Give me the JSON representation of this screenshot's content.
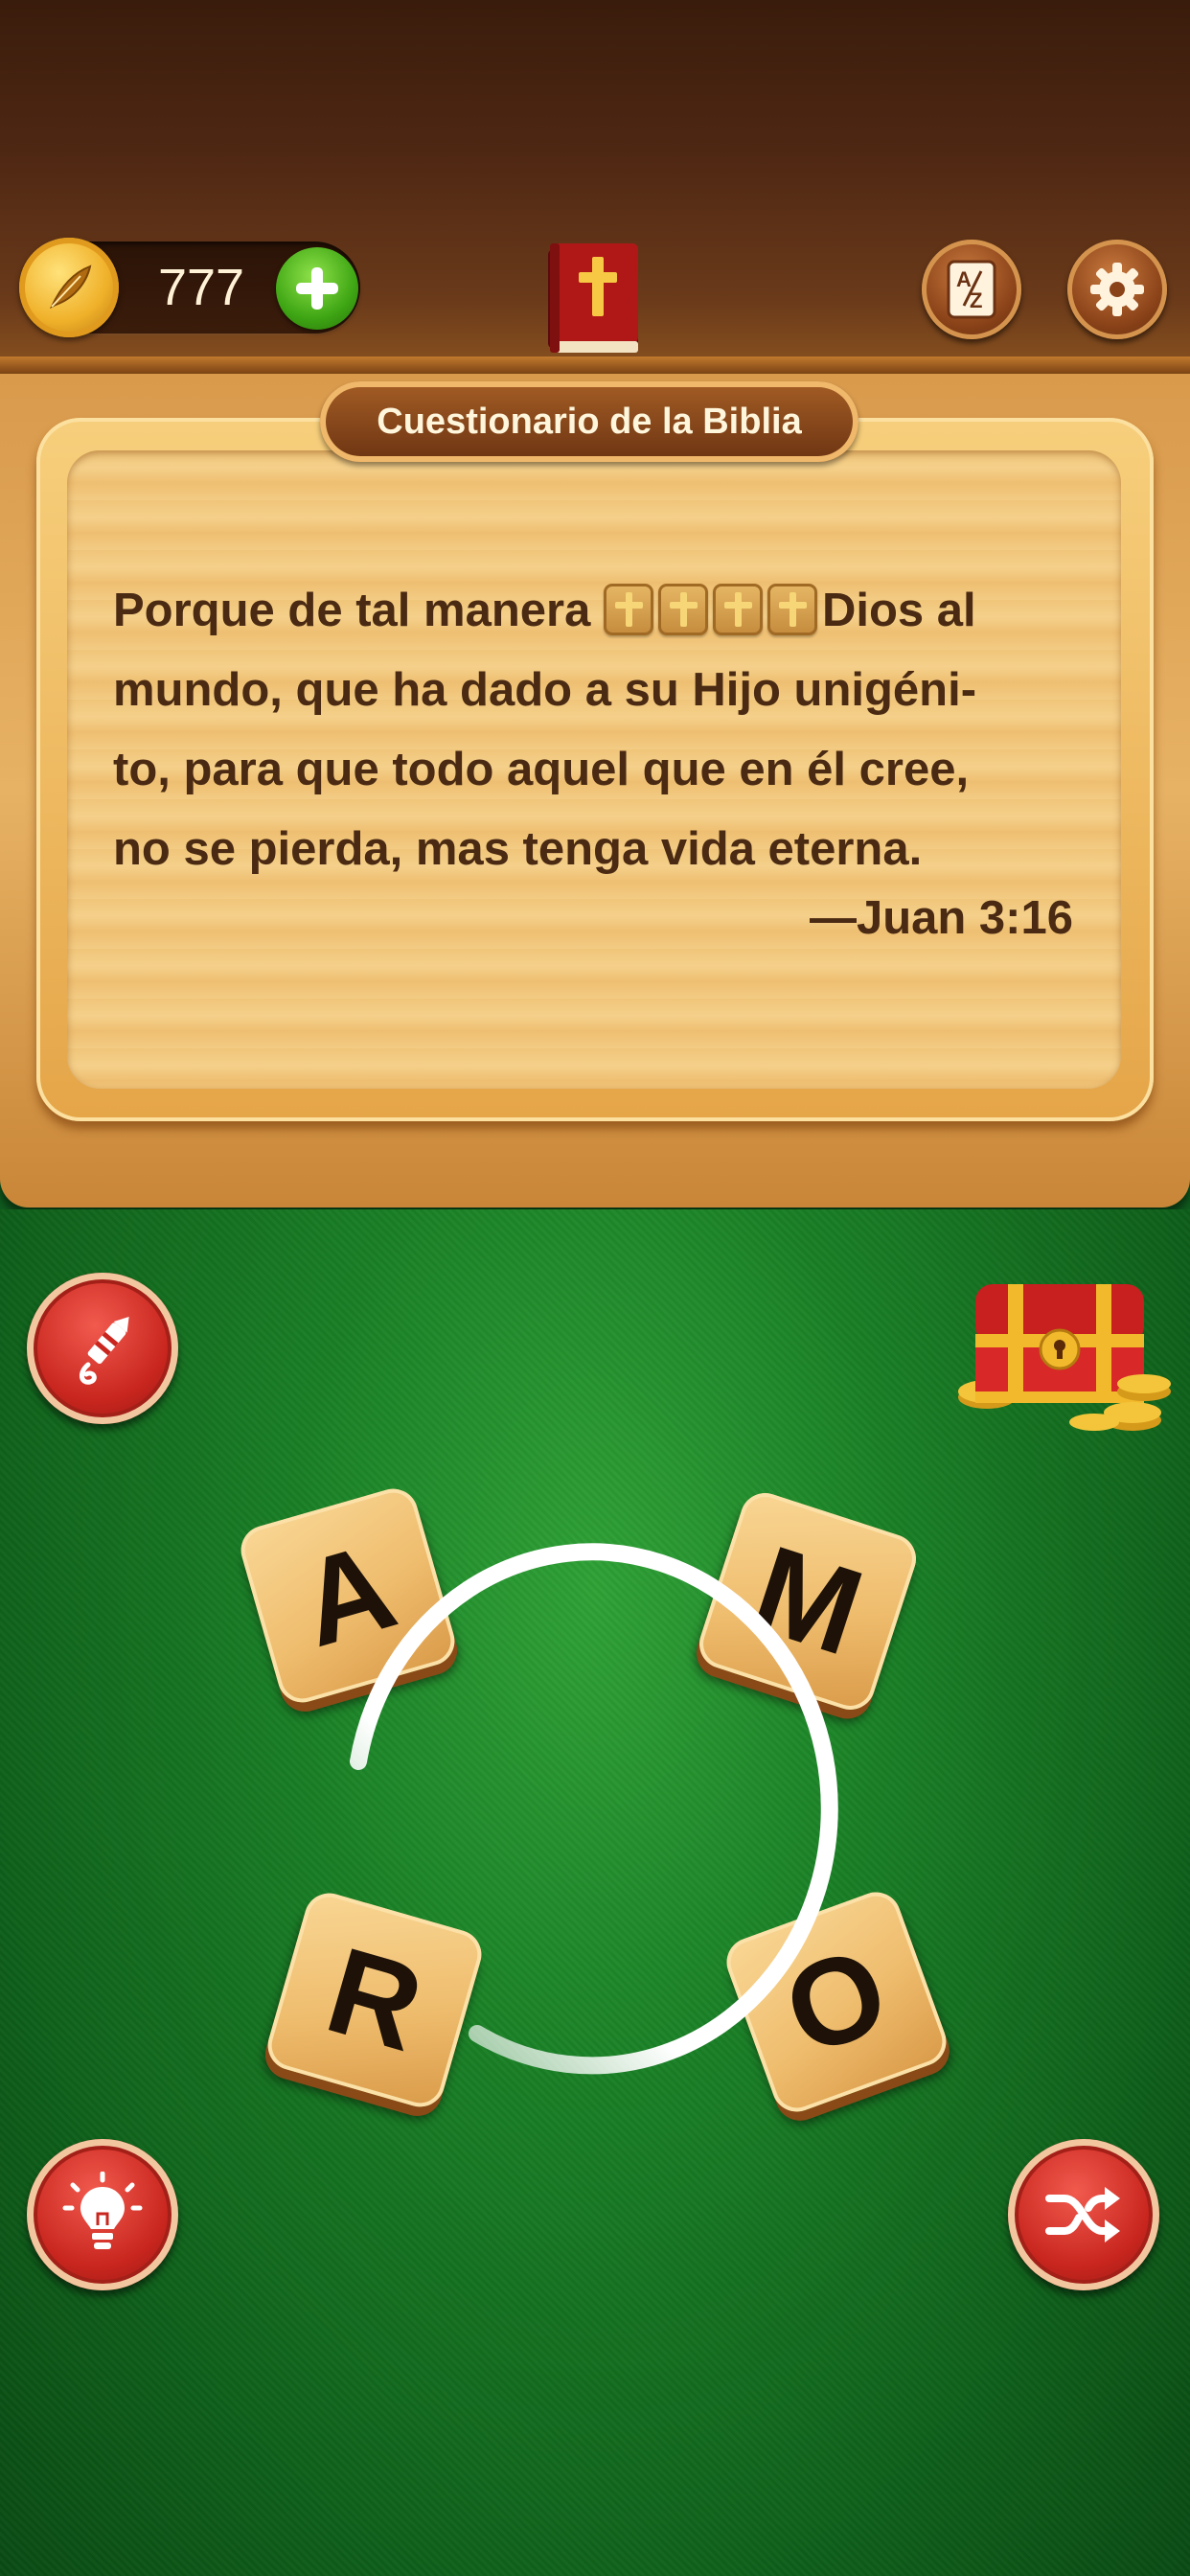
{
  "header": {
    "coins": "777",
    "colors": {
      "bar": "#4e2713",
      "coin": "#f0b12a",
      "plus": "#3fa614"
    }
  },
  "icons": {
    "coin": "feather-coin-icon",
    "add": "plus-icon",
    "book": "bible-cross-icon",
    "dictionary": "a-z-dictionary-icon",
    "settings": "gear-icon",
    "firework": "firework-rocket-icon",
    "chest": "treasure-chest-icon",
    "hint": "lightbulb-icon",
    "shuffle": "shuffle-icon"
  },
  "board": {
    "title": "Cuestionario de la Biblia",
    "verse_start": "Porque de tal manera",
    "blank_count": 4,
    "verse_after_blanks": "Dios al",
    "verse_lines": [
      "mundo, que ha dado a su Hijo unigéni-",
      "to, para que todo aquel que en él cree,",
      "no se pierda, mas tenga vida eterna."
    ],
    "reference": "—Juan 3:16"
  },
  "tiles": {
    "letters": [
      "A",
      "M",
      "R",
      "O"
    ]
  }
}
